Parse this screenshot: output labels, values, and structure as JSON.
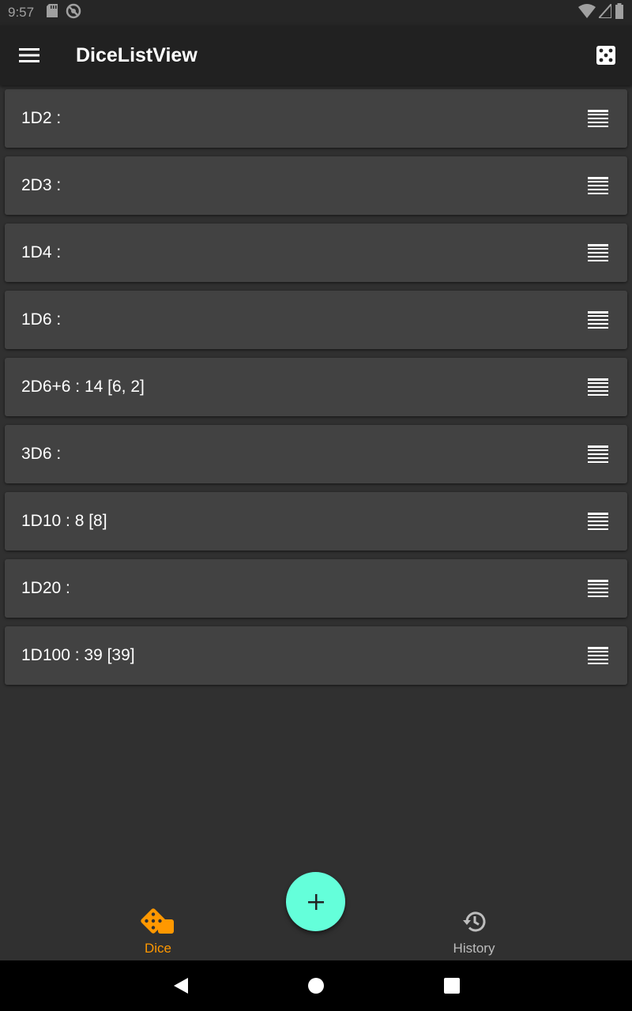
{
  "status_bar": {
    "time": "9:57",
    "left_icons": [
      "sd-card-icon",
      "block-icon"
    ],
    "right_icons": [
      "wifi-icon",
      "signal-icon",
      "battery-icon"
    ]
  },
  "app_bar": {
    "title": "DiceListView",
    "menu_icon": "hamburger-icon",
    "action_icon": "dice-icon"
  },
  "dice_list": [
    {
      "label": "1D2 :"
    },
    {
      "label": "2D3 :"
    },
    {
      "label": "1D4 :"
    },
    {
      "label": "1D6 :"
    },
    {
      "label": "2D6+6 : 14 [6, 2]"
    },
    {
      "label": "3D6 :"
    },
    {
      "label": "1D10 : 8 [8]"
    },
    {
      "label": "1D20 :"
    },
    {
      "label": "1D100 : 39 [39]"
    }
  ],
  "fab": {
    "icon": "plus-icon"
  },
  "bottom_nav": {
    "dice_label": "Dice",
    "history_label": "History",
    "active": "Dice"
  },
  "colors": {
    "accent": "#64ffda",
    "active_nav": "#ff9800",
    "card": "#424242",
    "background": "#303030",
    "app_bar": "#212121"
  },
  "system_nav": [
    "back-icon",
    "home-icon",
    "recents-icon"
  ]
}
